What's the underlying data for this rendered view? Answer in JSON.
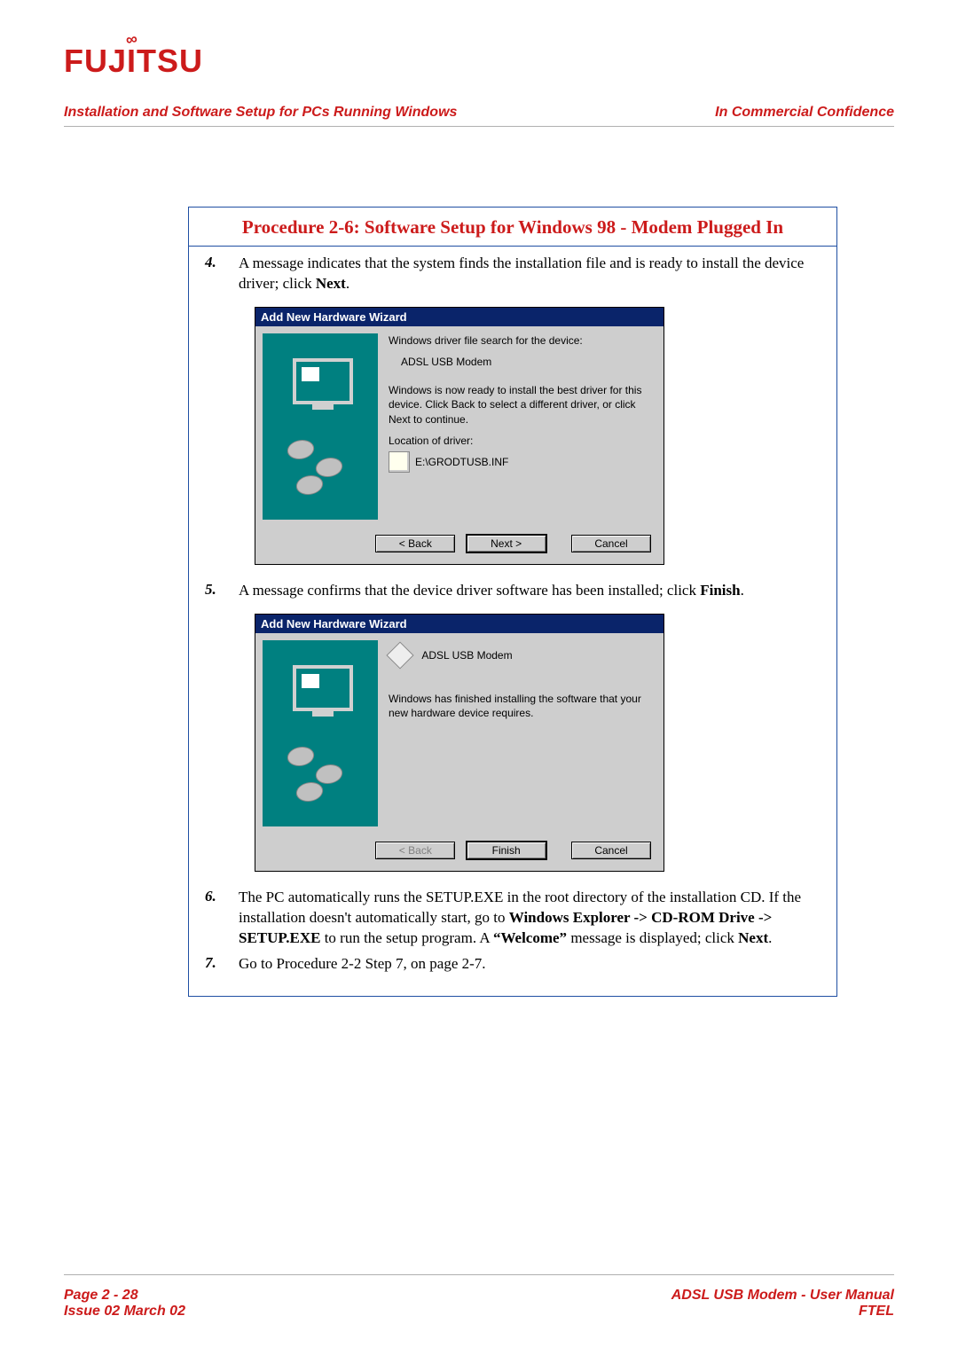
{
  "brand": "FUJITSU",
  "header": {
    "left": "Installation and Software Setup for PCs Running Windows",
    "right": "In Commercial Confidence"
  },
  "procedure": {
    "title": "Procedure 2-6: Software Setup for Windows 98 - Modem Plugged In",
    "steps": [
      {
        "num": "4.",
        "text_pre": "A message indicates that the system finds the installation file and is ready to install the device driver; click ",
        "bold1": "Next",
        "text_post": "."
      },
      {
        "num": "5.",
        "text_pre": "A message confirms that the device driver software has been installed; click ",
        "bold1": "Finish",
        "text_post": "."
      },
      {
        "num": "6.",
        "seg1": "The PC automatically runs the SETUP.EXE in the root directory of the installation CD. If the installation doesn't automatically start, go to ",
        "bold1": "Windows Explorer -> CD-ROM Drive -> SETUP.EXE",
        "seg2": " to run the setup program. A ",
        "bold2": "“Welcome”",
        "seg3": " message is displayed; click ",
        "bold3": "Next",
        "seg4": "."
      },
      {
        "num": "7.",
        "text_pre": "Go to Procedure 2-2  Step 7, on page 2-7."
      }
    ]
  },
  "wizard1": {
    "title": "Add New Hardware Wizard",
    "line1": "Windows driver file search for the device:",
    "device": "ADSL USB Modem",
    "line2": "Windows is now ready to install the best driver for this device. Click Back to select a different driver, or click Next to continue.",
    "loc_label": "Location of driver:",
    "loc_path": "E:\\GRODTUSB.INF",
    "btn_back": "< Back",
    "btn_next": "Next >",
    "btn_cancel": "Cancel"
  },
  "wizard2": {
    "title": "Add New Hardware Wizard",
    "device": "ADSL USB Modem",
    "line1": "Windows has finished installing the software that your new hardware device requires.",
    "btn_back": "< Back",
    "btn_finish": "Finish",
    "btn_cancel": "Cancel"
  },
  "footer": {
    "left1": "Page 2 - 28",
    "left2": "Issue 02 March 02",
    "right1": "ADSL USB Modem - User Manual",
    "right2": "FTEL"
  }
}
